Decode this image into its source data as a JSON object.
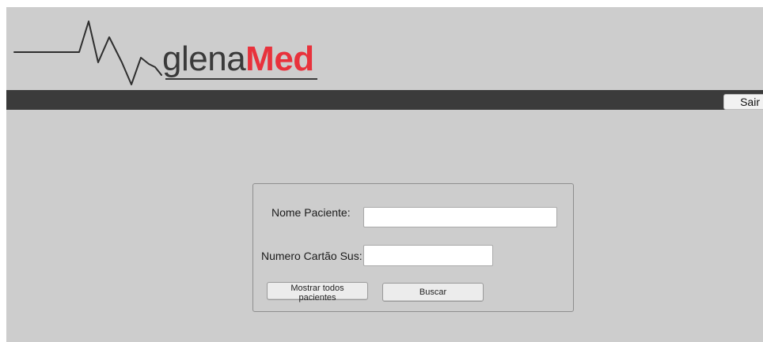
{
  "brand": {
    "name_part_a": "glena",
    "name_part_b": "Med",
    "accent_color": "#e8323c"
  },
  "header": {
    "logout_label": "Sair"
  },
  "search": {
    "name_label": "Nome Paciente:",
    "name_value": "",
    "card_label": "Numero Cartão Sus:",
    "card_value": "",
    "show_all_label": "Mostrar todos pacientes",
    "search_label": "Buscar"
  }
}
